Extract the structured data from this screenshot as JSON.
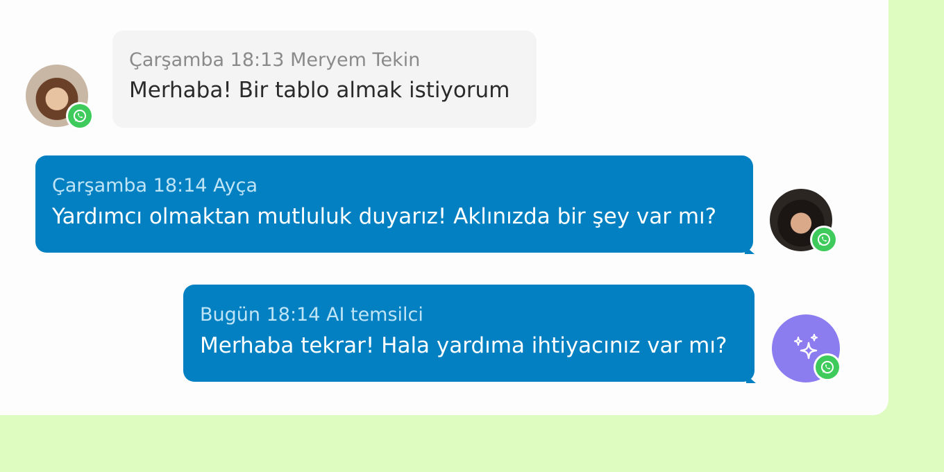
{
  "messages": [
    {
      "direction": "incoming",
      "day": "Çarşamba",
      "time": "18:13",
      "author": "Meryem Tekin",
      "meta": "Çarşamba 18:13 Meryem Tekin",
      "text": "Merhaba! Bir tablo almak istiyorum",
      "channel": "whatsapp-icon"
    },
    {
      "direction": "outgoing",
      "day": "Çarşamba",
      "time": "18:14",
      "author": "Ayça",
      "meta": "Çarşamba 18:14 Ayça",
      "text": "Yardımcı olmaktan mutluluk duyarız! Aklınızda bir şey var mı?",
      "channel": "whatsapp-icon"
    },
    {
      "direction": "outgoing",
      "day": "Bugün",
      "time": "18:14",
      "author": "AI temsilci",
      "meta": "Bugün 18:14 AI temsilci",
      "text": "Merhaba tekrar! Hala yardıma ihtiyacınız var mı?",
      "channel": "whatsapp-icon",
      "avatar_icon": "sparkles-icon"
    }
  ],
  "colors": {
    "page_background": "#dffcc0",
    "panel_background": "#fdfdfd",
    "incoming_bubble": "#f4f4f4",
    "outgoing_bubble": "#0280c2",
    "ai_avatar": "#8b7cf0",
    "whatsapp_green": "#3ecb5c"
  }
}
